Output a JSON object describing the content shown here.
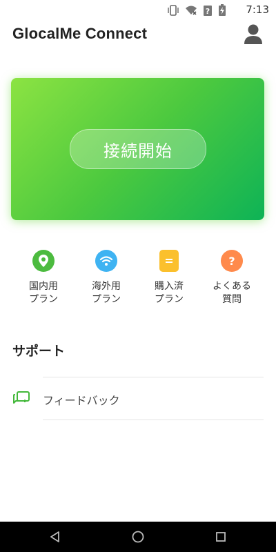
{
  "status_bar": {
    "time": "7:13",
    "icons": [
      "vibrate-icon",
      "wifi-off-icon",
      "signal-unknown-icon",
      "battery-charging-icon"
    ]
  },
  "header": {
    "title": "GlocalMe Connect",
    "profile_icon": "person-icon"
  },
  "connect_card": {
    "button_label": "接続開始",
    "colors": {
      "start": "#8ce342",
      "end": "#0eb356"
    }
  },
  "quick_menu": [
    {
      "line1": "国内用",
      "line2": "プラン",
      "icon": "location-pin-icon",
      "color": "#4cbb3f"
    },
    {
      "line1": "海外用",
      "line2": "プラン",
      "icon": "wifi-icon",
      "color": "#3fb3f2"
    },
    {
      "line1": "購入済",
      "line2": "プラン",
      "icon": "clipboard-icon",
      "color": "#fbc02d"
    },
    {
      "line1": "よくある",
      "line2": "質問",
      "icon": "question-icon",
      "color": "#ff8a4c"
    }
  ],
  "support": {
    "title": "サポート",
    "items": [
      {
        "label": "フィードバック",
        "icon": "feedback-icon",
        "color": "#43b83a"
      }
    ]
  },
  "nav_bar": {
    "icons": [
      "back-icon",
      "home-icon",
      "recents-icon"
    ]
  }
}
